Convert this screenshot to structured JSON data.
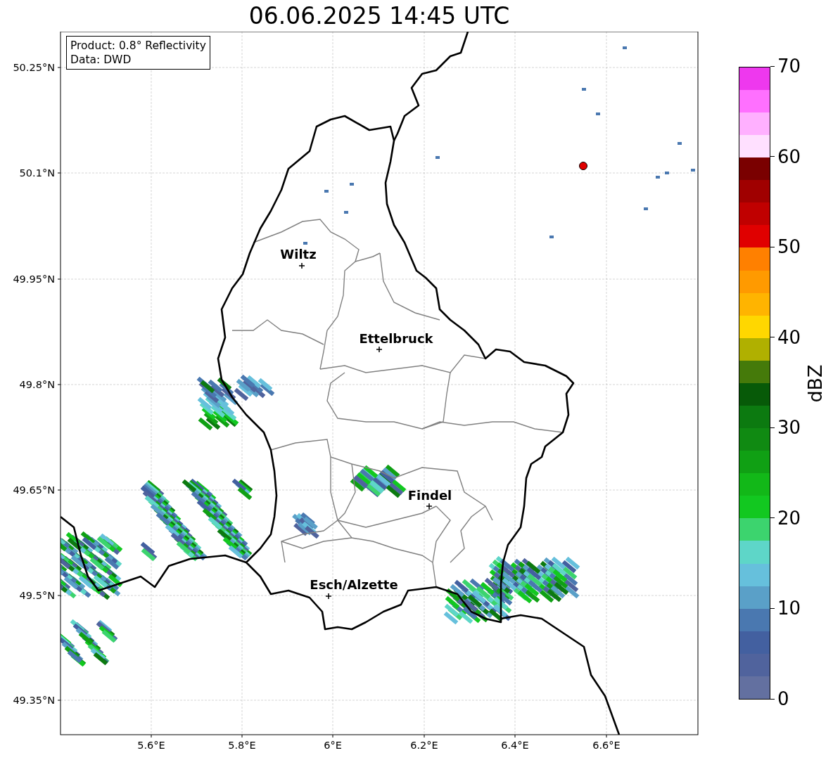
{
  "title": "06.06.2025 14:45 UTC",
  "info_box": {
    "lines": [
      "Product: 0.8° Reflectivity",
      "Data: DWD"
    ]
  },
  "map": {
    "y_tick_labels": [
      "50.25°N",
      "50.1°N",
      "49.95°N",
      "49.8°N",
      "49.65°N",
      "49.5°N",
      "49.35°N"
    ],
    "x_tick_labels": [
      "5.6°E",
      "5.8°E",
      "6°E",
      "6.2°E",
      "6.4°E",
      "6.6°E"
    ],
    "cities": [
      {
        "name": "Wiltz"
      },
      {
        "name": "Ettelbruck"
      },
      {
        "name": "Findel"
      },
      {
        "name": "Esch/Alzette"
      }
    ]
  },
  "colorbar": {
    "label": "dBZ",
    "tick_labels": [
      "70",
      "60",
      "50",
      "40",
      "30",
      "20",
      "10",
      "0"
    ],
    "segments": [
      {
        "color": "#6370a0"
      },
      {
        "color": "#50639d"
      },
      {
        "color": "#4360a0"
      },
      {
        "color": "#4a78b0"
      },
      {
        "color": "#5aa0c8"
      },
      {
        "color": "#66c0dc"
      },
      {
        "color": "#5ed6c8"
      },
      {
        "color": "#3cd46e"
      },
      {
        "color": "#12c820"
      },
      {
        "color": "#12b818"
      },
      {
        "color": "#10a014"
      },
      {
        "color": "#108a12"
      },
      {
        "color": "#0c7a10"
      },
      {
        "color": "#075a08"
      },
      {
        "color": "#457a0a"
      },
      {
        "color": "#b0b000"
      },
      {
        "color": "#ffd700"
      },
      {
        "color": "#ffb400"
      },
      {
        "color": "#ff9a00"
      },
      {
        "color": "#ff8000"
      },
      {
        "color": "#e00000"
      },
      {
        "color": "#c00000"
      },
      {
        "color": "#a00000"
      },
      {
        "color": "#7a0000"
      },
      {
        "color": "#ffe0ff"
      },
      {
        "color": "#ffb0ff"
      },
      {
        "color": "#ff70ff"
      },
      {
        "color": "#ee38ee"
      }
    ]
  }
}
